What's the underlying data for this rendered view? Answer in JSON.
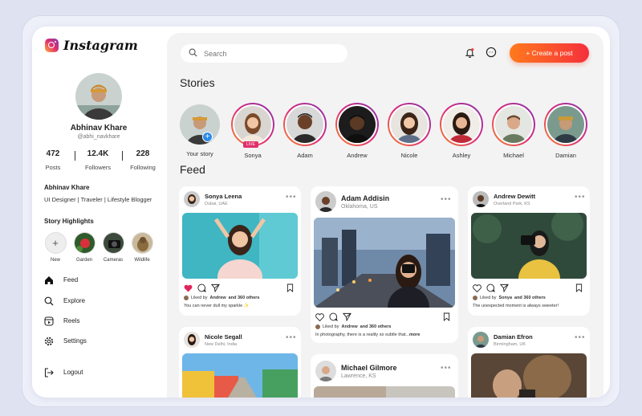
{
  "brand": {
    "name": "Instagram"
  },
  "profile": {
    "name": "Abhinav Khare",
    "handle": "@abhi_navkhare",
    "stats": [
      {
        "value": "472",
        "label": "Posts"
      },
      {
        "value": "12.4K",
        "label": "Followers"
      },
      {
        "value": "228",
        "label": "Following"
      }
    ],
    "bio_name": "Abhinav Khare",
    "bio": "UI Designer | Traveler | Lifestyle Blogger"
  },
  "highlights": {
    "title": "Story Highlights",
    "items": [
      "New",
      "Garden",
      "Cameras",
      "Wildlife"
    ]
  },
  "nav": [
    {
      "label": "Feed",
      "icon": "home-icon"
    },
    {
      "label": "Explore",
      "icon": "search-icon"
    },
    {
      "label": "Reels",
      "icon": "reels-icon"
    },
    {
      "label": "Settings",
      "icon": "gear-icon"
    },
    {
      "label": "Logout",
      "icon": "logout-icon"
    }
  ],
  "search": {
    "placeholder": "Search"
  },
  "header": {
    "create_label": "+ Create a post"
  },
  "stories": {
    "title": "Stories",
    "live_badge": "LIVE",
    "items": [
      "Your story",
      "Sonya",
      "Adam",
      "Andrew",
      "Nicole",
      "Ashley",
      "Michael",
      "Damian"
    ]
  },
  "feed": {
    "title": "Feed",
    "posts": [
      {
        "name": "Sonya Leena",
        "location": "Dubai, UAE",
        "liked_prefix": "Liked by",
        "liked_name": "Andrew",
        "liked_suffix": "and 360 others",
        "caption": "You can never dull my sparkle ✨"
      },
      {
        "name": "Adam Addisin",
        "location": "Oklahoma, US",
        "liked_prefix": "Liked by",
        "liked_name": "Andrew",
        "liked_suffix": "and 360 others",
        "caption": "In photography, there is a reality so subtle that...",
        "more": "more"
      },
      {
        "name": "Andrew Dewitt",
        "location": "Overland Park, KS",
        "liked_prefix": "Liked by",
        "liked_name": "Sonya",
        "liked_suffix": "and 360 others",
        "caption": "The unexpected moment is always sweeter!"
      },
      {
        "name": "Nicole Segall",
        "location": "New Delhi, India"
      },
      {
        "name": "Michael Gilmore",
        "location": "Lawrence, KS"
      },
      {
        "name": "Damian Efron",
        "location": "Birmingham, UK"
      }
    ]
  },
  "colors": {
    "accent_start": "#ff7a1c",
    "accent_end": "#f5303c",
    "story_ring": "#dd2a7b",
    "like": "#e0245e"
  }
}
